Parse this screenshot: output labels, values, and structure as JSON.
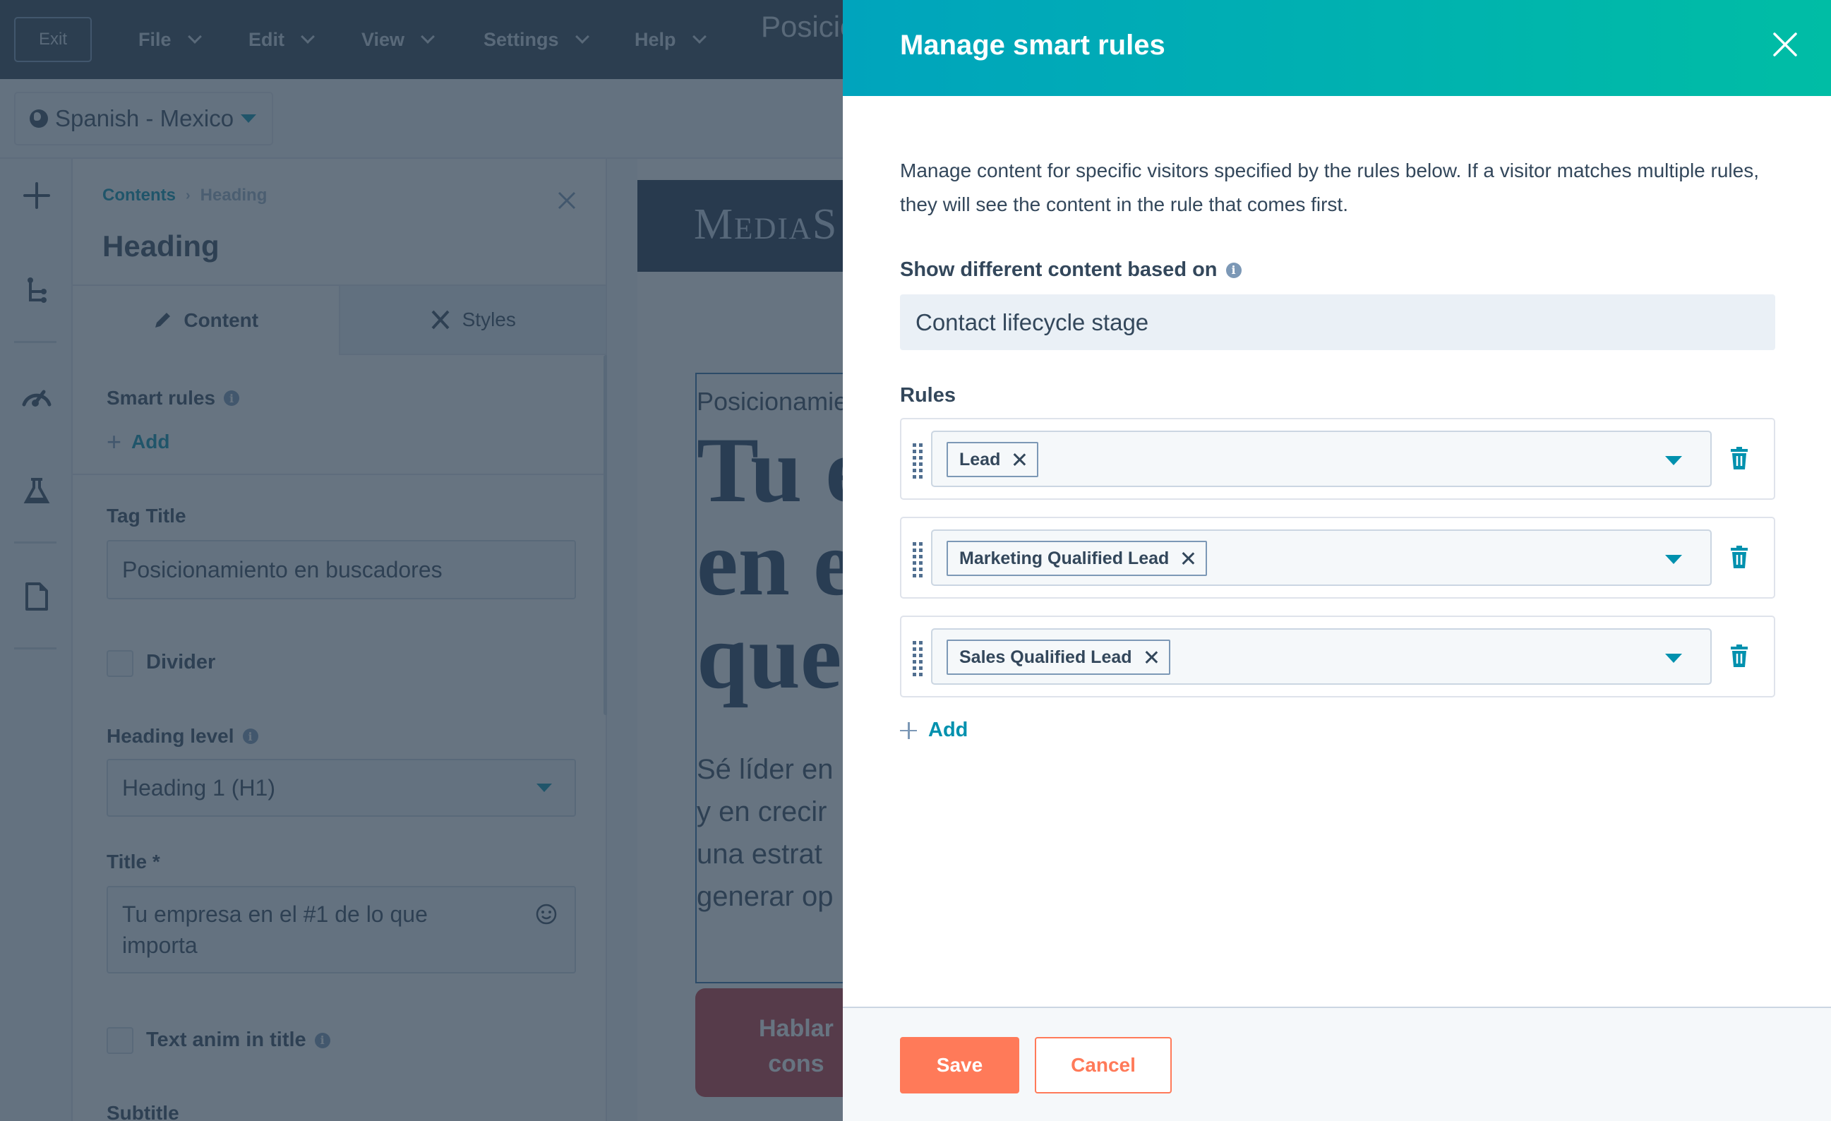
{
  "topbar": {
    "exit_label": "Exit",
    "menus": [
      {
        "label": "File"
      },
      {
        "label": "Edit"
      },
      {
        "label": "View"
      },
      {
        "label": "Settings"
      },
      {
        "label": "Help"
      }
    ],
    "page_name": "Posicionamiento en buscadores"
  },
  "locale": {
    "label": "Spanish - Mexico",
    "icon": "globe-icon"
  },
  "rail": {
    "icons": [
      "plus-icon",
      "tree-icon",
      "speedometer-icon",
      "flask-icon",
      "page-icon"
    ]
  },
  "panel": {
    "breadcrumb": {
      "parent": "Contents",
      "separator": "›",
      "current": "Heading"
    },
    "title": "Heading",
    "tabs": [
      {
        "label": "Content",
        "icon": "pencil-icon",
        "active": true
      },
      {
        "label": "Styles",
        "icon": "brush-icon",
        "active": false
      }
    ],
    "smart_rules": {
      "label": "Smart rules",
      "add_label": "Add"
    },
    "tag_title": {
      "label": "Tag Title",
      "value": "Posicionamiento en buscadores"
    },
    "divider": {
      "label": "Divider",
      "checked": false
    },
    "heading_level": {
      "label": "Heading level",
      "value": "Heading 1 (H1)"
    },
    "title_field": {
      "label": "Title *",
      "value_line1": "Tu empresa en el #1 de lo que",
      "value_line2": "importa"
    },
    "text_anim": {
      "label": "Text anim in title",
      "checked": false
    },
    "subtitle": {
      "label": "Subtitle"
    }
  },
  "preview": {
    "brand": "MediaS",
    "eyebrow": "Posicionamie",
    "title_lines": [
      "Tu e",
      "en e",
      "que"
    ],
    "body_lines": [
      "Sé líder en",
      "y en crecir",
      "una estrat",
      "generar op"
    ],
    "cta_lines": [
      "Hablar",
      "cons"
    ]
  },
  "modal": {
    "title": "Manage smart rules",
    "description": "Manage content for specific visitors specified by the rules below. If a visitor matches multiple rules, they will see the content in the rule that comes first.",
    "based_on_label": "Show different content based on",
    "based_on_value": "Contact lifecycle stage",
    "rules_label": "Rules",
    "rules": [
      {
        "tag": "Lead"
      },
      {
        "tag": "Marketing Qualified Lead"
      },
      {
        "tag": "Sales Qualified Lead"
      }
    ],
    "add_label": "Add",
    "save_label": "Save",
    "cancel_label": "Cancel"
  },
  "colors": {
    "header_gradient_start": "#00a4bd",
    "header_gradient_end": "#00bda5",
    "primary_button": "#ff7a59",
    "link_teal": "#0091ae",
    "text_dark": "#33475b",
    "topbar_bg": "#2d3e50"
  }
}
